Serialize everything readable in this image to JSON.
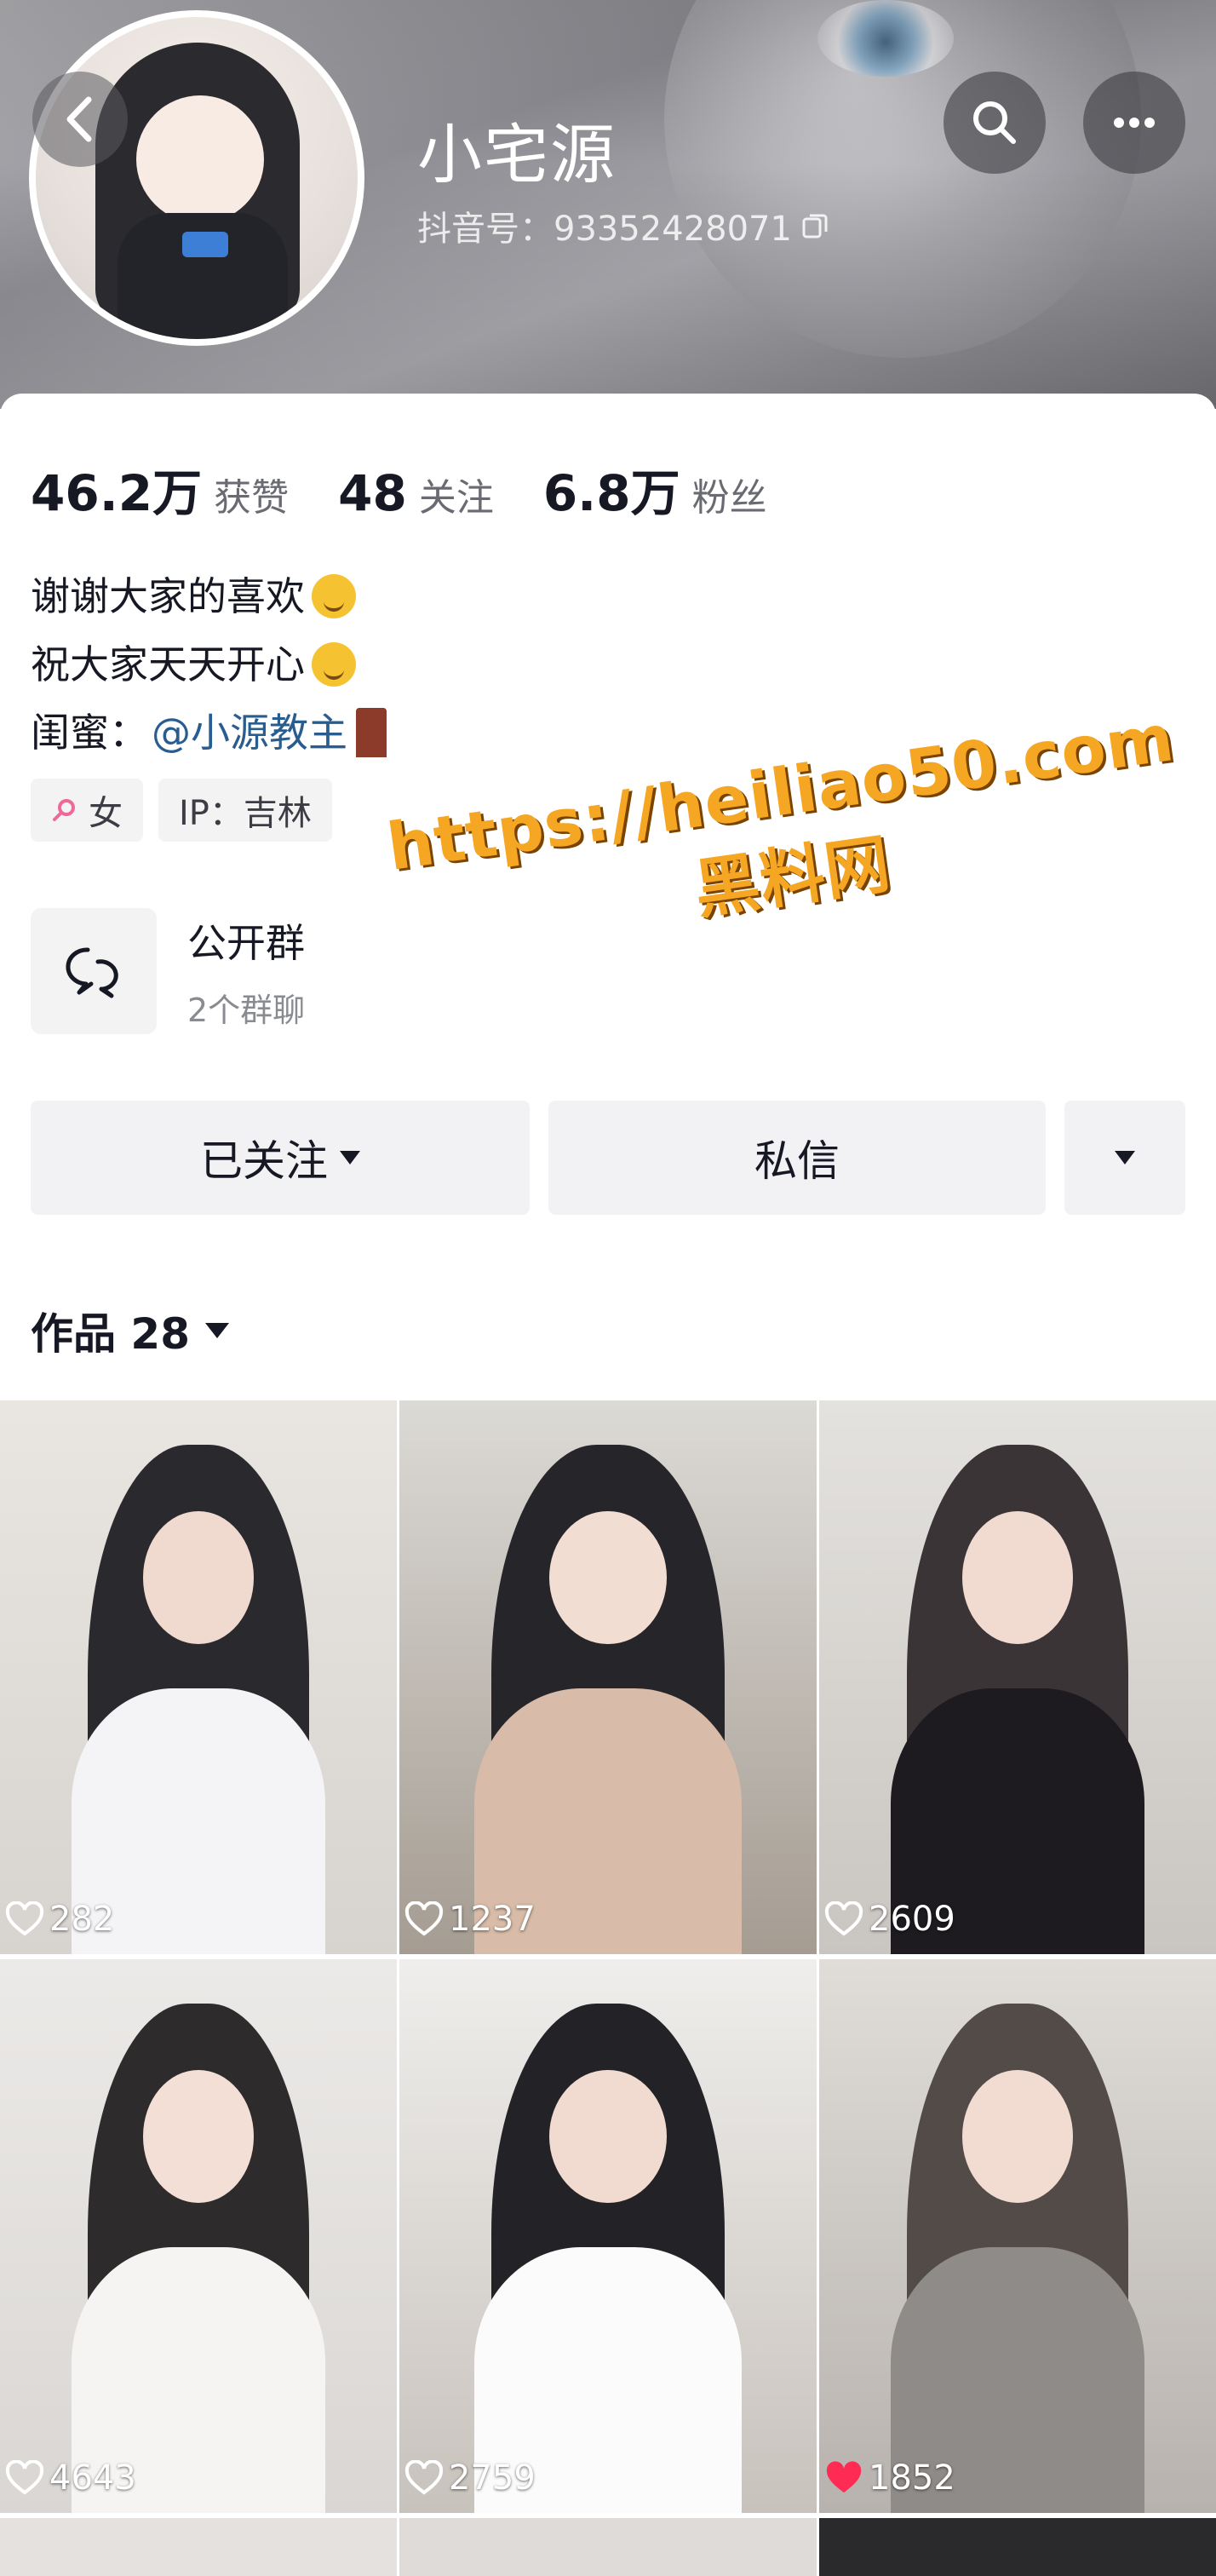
{
  "header": {
    "nickname": "小宅源",
    "douyin_id": "抖音号：93352428071"
  },
  "stats": [
    {
      "num": "46.2万",
      "label": "获赞"
    },
    {
      "num": "48",
      "label": "关注"
    },
    {
      "num": "6.8万",
      "label": "粉丝"
    }
  ],
  "bio": {
    "line1": "谢谢大家的喜欢",
    "line2": "祝大家天天开心",
    "line3_prefix": "闺蜜：",
    "line3_mention": "@小源教主"
  },
  "tags": {
    "gender": "女",
    "ip": "IP：吉林"
  },
  "group": {
    "title": "公开群",
    "subtitle": "2个群聊"
  },
  "watermark": {
    "line1": "https://heiliao50.com",
    "line2": "黑料网"
  },
  "actions": {
    "followed": "已关注",
    "message": "私信"
  },
  "works": {
    "label": "作品 28"
  },
  "videos": [
    {
      "likes": "282",
      "liked": false
    },
    {
      "likes": "1237",
      "liked": false
    },
    {
      "likes": "2609",
      "liked": false
    },
    {
      "likes": "4643",
      "liked": false
    },
    {
      "likes": "2759",
      "liked": false
    },
    {
      "likes": "1852",
      "liked": true
    }
  ],
  "colors": {
    "mention": "#2a5d8f",
    "liked_heart": "#fe2c55",
    "watermark": "#f5a623"
  }
}
